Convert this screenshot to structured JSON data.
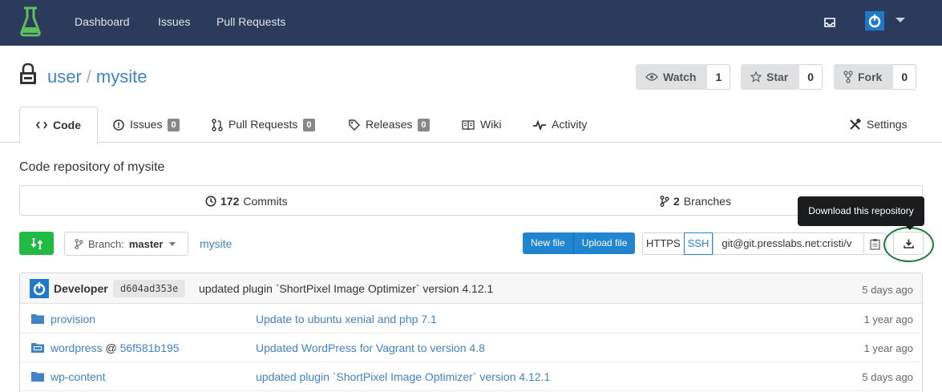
{
  "nav": {
    "items": [
      "Dashboard",
      "Issues",
      "Pull Requests"
    ],
    "icons": {
      "logo": "flask-icon",
      "inbox": "inbox-icon",
      "avatar": "power-avatar-icon"
    },
    "background": "#2c3a5c"
  },
  "repo": {
    "owner": "user",
    "separator": "/",
    "name": "mysite",
    "watch_label": "Watch",
    "watch_count": "1",
    "star_label": "Star",
    "star_count": "0",
    "fork_label": "Fork",
    "fork_count": "0"
  },
  "tabs": [
    {
      "label": "Code"
    },
    {
      "label": "Issues",
      "badge": "0"
    },
    {
      "label": "Pull Requests",
      "badge": "0"
    },
    {
      "label": "Releases",
      "badge": "0"
    },
    {
      "label": "Wiki"
    },
    {
      "label": "Activity"
    },
    {
      "label": "Settings"
    }
  ],
  "description": "Code repository of mysite",
  "stats": {
    "commits_count": "172",
    "commits_label": "Commits",
    "branches_count": "2",
    "branches_label": "Branches"
  },
  "toolbar": {
    "branch_prefix": "Branch:",
    "branch_name": "master",
    "breadcrumb": "mysite",
    "new_file": "New file",
    "upload_file": "Upload file",
    "https_label": "HTTPS",
    "ssh_label": "SSH",
    "clone_url": "git@git.presslabs.net:cristi/v",
    "download_tooltip": "Download this repository",
    "accent": "#2185d0",
    "green": "#21ba45"
  },
  "last_commit": {
    "author": "Developer",
    "sha": "d604ad353e",
    "message": "updated plugin `ShortPixel Image Optimizer` version 4.12.1",
    "when": "5 days ago"
  },
  "files": [
    {
      "name": "provision",
      "at": "",
      "ref": "",
      "message": "Update to ubuntu xenial and php 7.1",
      "when": "1 year ago",
      "icon": "folder-icon"
    },
    {
      "name": "wordpress",
      "at": "@",
      "ref": "56f581b195",
      "message": "Updated WordPress for Vagrant to version 4.8",
      "when": "1 year ago",
      "icon": "submodule-folder-icon"
    },
    {
      "name": "wp-content",
      "at": "",
      "ref": "",
      "message": "updated plugin `ShortPixel Image Optimizer` version 4.12.1",
      "when": "5 days ago",
      "icon": "folder-icon"
    }
  ]
}
